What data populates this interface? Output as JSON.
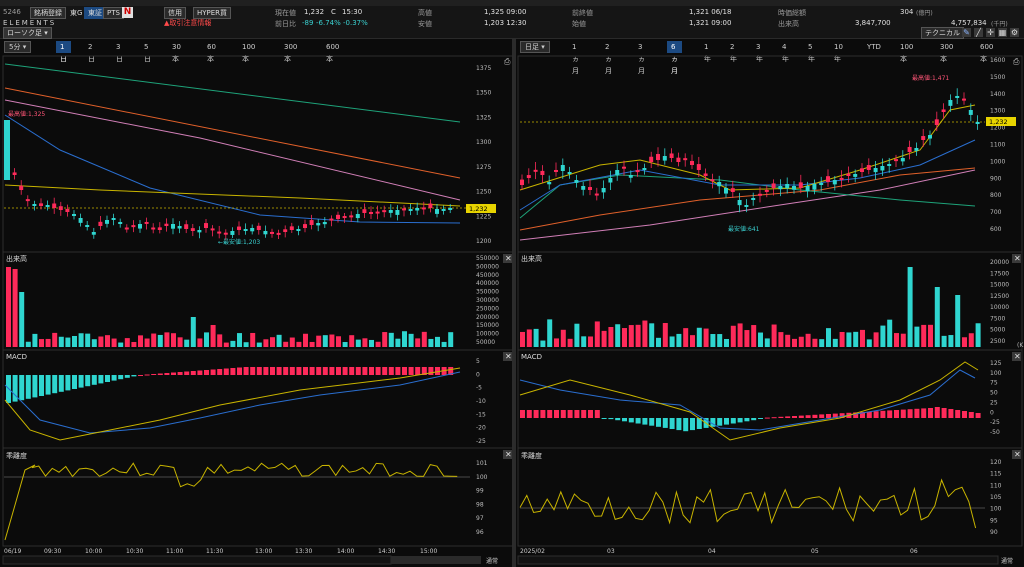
{
  "header": {
    "code": "5246",
    "list_btn": "銘柄登録",
    "market": "東G",
    "ex1": "東証",
    "ex2": "PTS",
    "app_logo": "N",
    "brand": "ELEMENTS",
    "tag1": "信用",
    "tag2": "HYPER買",
    "warning": "取引注意情報",
    "price_label": "現在値",
    "price": "1,232",
    "price_flag": "C",
    "price_time": "15:30",
    "change_label": "前日比",
    "change": "-89",
    "change_pct": "-6.74%",
    "change_pct2": "-0.37%",
    "high_label": "高値",
    "high": "1,325 09:00",
    "low_label": "安値",
    "low": "1,203 12:30",
    "prev_label": "前終値",
    "prev": "1,321 06/18",
    "open_label": "始値",
    "open": "1,321 09:00",
    "mcap_label": "時価総額",
    "mcap": "304",
    "mcap_unit": "(億円)",
    "vol_label": "出来高",
    "vol": "3,847,700",
    "turnover": "4,757,834",
    "turnover_unit": "(千円)",
    "tech_btn": "テクニカル",
    "chart_type": "ローソク足"
  },
  "left_toolbar": {
    "interval": "5分",
    "ranges": [
      "1日",
      "2日",
      "3日",
      "5日",
      "30本",
      "60本",
      "100本",
      "300本",
      "600本"
    ],
    "active": 0
  },
  "right_toolbar": {
    "interval": "日足",
    "ranges": [
      "1ヵ月",
      "2ヵ月",
      "3ヵ月",
      "6ヵ月",
      "1年",
      "2年",
      "3年",
      "4年",
      "5年",
      "10年",
      "YTD",
      "100本",
      "300本",
      "600本"
    ],
    "active": 3
  },
  "panels": {
    "volume": "出来高",
    "macd": "MACD",
    "psy": "乖離度",
    "mode": "通常"
  },
  "colors": {
    "up": "#ff2a5a",
    "down": "#2fd6d0",
    "bg": "#0b0b0b",
    "yellow": "#c8b400"
  },
  "left": {
    "price_axis": [
      "1375",
      "1350",
      "1325",
      "1300",
      "1275",
      "1250",
      "1225",
      "1200"
    ],
    "price_tag": "1,232",
    "high_note": "最高値:1,325",
    "low_note": "←最安値:1,203",
    "vol_axis": [
      "550000",
      "500000",
      "450000",
      "400000",
      "350000",
      "300000",
      "250000",
      "200000",
      "150000",
      "100000",
      "50000"
    ],
    "macd_axis": [
      "5",
      "0",
      "-5",
      "-10",
      "-15",
      "-20",
      "-25"
    ],
    "psy_axis": [
      "101",
      "100",
      "99",
      "98",
      "97",
      "96"
    ],
    "time_axis": [
      "06/19",
      "09:30",
      "10:00",
      "10:30",
      "11:00",
      "11:30",
      "13:00",
      "13:30",
      "14:00",
      "14:30",
      "15:00"
    ]
  },
  "right": {
    "price_axis": [
      "1600",
      "1500",
      "1400",
      "1300",
      "1200",
      "1100",
      "1000",
      "900",
      "800",
      "700",
      "600"
    ],
    "price_tag": "1,232",
    "high_note": "最高値:1,471",
    "low_note": "最安値:641",
    "vol_axis": [
      "20000",
      "17500",
      "15000",
      "12500",
      "10000",
      "7500",
      "5000",
      "2500"
    ],
    "vol_unit": "(K",
    "macd_axis": [
      "125",
      "100",
      "75",
      "50",
      "25",
      "0",
      "-25",
      "-50"
    ],
    "psy_axis": [
      "120",
      "115",
      "110",
      "105",
      "100",
      "95",
      "90"
    ],
    "time_axis": [
      "2025/02",
      "03",
      "04",
      "05",
      "06"
    ]
  }
}
